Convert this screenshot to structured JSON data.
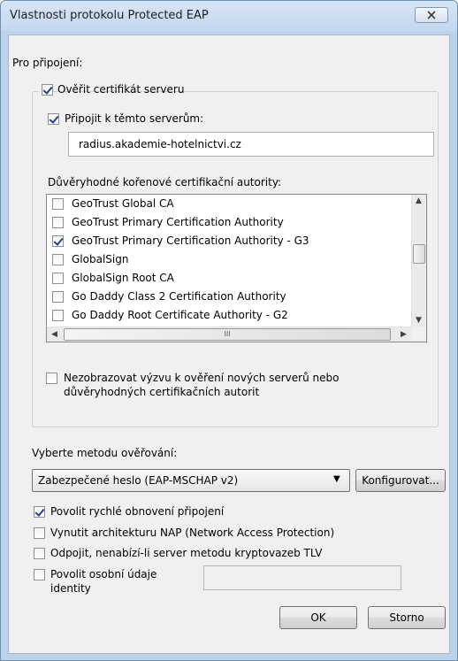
{
  "window": {
    "title": "Vlastnosti protokolu Protected EAP"
  },
  "connection": {
    "heading": "Pro připojení:",
    "verify_cert": {
      "label": "Ověřit certifikát serveru",
      "checked": true
    },
    "connect_servers": {
      "label": "Připojit k těmto serverům:",
      "checked": true
    },
    "server_value": "radius.akademie-hotelnictvi.cz",
    "trusted_ca_label": "Důvěryhodné kořenové certifikační autority:",
    "ca_list": [
      {
        "label": "GeoTrust Global CA",
        "checked": false
      },
      {
        "label": "GeoTrust Primary Certification Authority",
        "checked": false
      },
      {
        "label": "GeoTrust Primary Certification Authority - G3",
        "checked": true
      },
      {
        "label": "GlobalSign",
        "checked": false
      },
      {
        "label": "GlobalSign Root CA",
        "checked": false
      },
      {
        "label": "Go Daddy Class 2 Certification Authority",
        "checked": false
      },
      {
        "label": "Go Daddy Root Certificate Authority - G2",
        "checked": false
      }
    ],
    "hscroll_thumb_label": "III",
    "no_prompt": {
      "line1": "Nezobrazovat výzvu k ověření nových serverů nebo",
      "line2": "důvěryhodných certifikačních autorit",
      "checked": false
    }
  },
  "auth": {
    "label": "Vyberte metodu ověřování:",
    "method": "Zabezpečené heslo (EAP-MSCHAP v2)",
    "configure_label": "Konfigurovat..."
  },
  "options": {
    "fast_reconnect": {
      "label": "Povolit rychlé obnovení připojení",
      "checked": true
    },
    "nap": {
      "label": "Vynutit architekturu NAP (Network Access Protection)",
      "checked": false
    },
    "disconnect_tlv": {
      "label": "Odpojit, nenabízí-li server metodu kryptovazeb TLV",
      "checked": false
    },
    "identity_privacy": {
      "line1": "Povolit osobní údaje",
      "line2": "identity",
      "checked": false,
      "value": ""
    }
  },
  "buttons": {
    "ok": "OK",
    "cancel": "Storno"
  }
}
